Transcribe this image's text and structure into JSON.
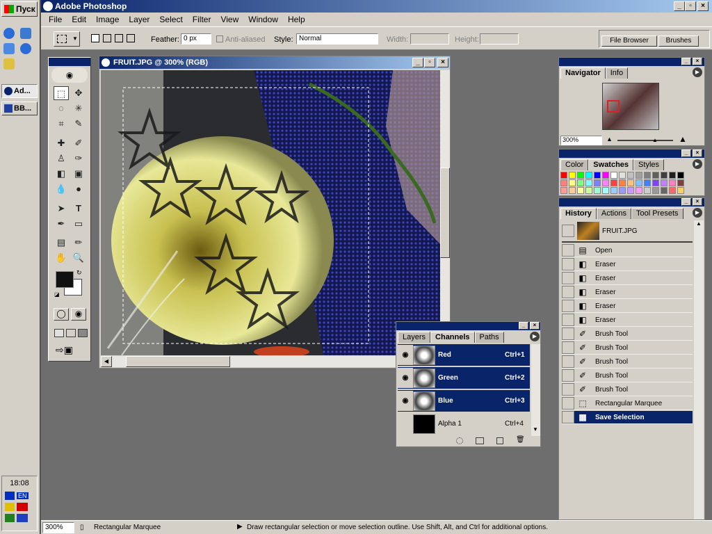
{
  "taskbar": {
    "start_label": "Пуск",
    "tasks": [
      "Ad...",
      "BB..."
    ],
    "clock": "18:08",
    "lang": "EN"
  },
  "app": {
    "title": "Adobe Photoshop",
    "menus": [
      "File",
      "Edit",
      "Image",
      "Layer",
      "Select",
      "Filter",
      "View",
      "Window",
      "Help"
    ]
  },
  "options": {
    "feather_label": "Feather:",
    "feather_value": "0 px",
    "antialiased_label": "Anti-aliased",
    "style_label": "Style:",
    "style_value": "Normal",
    "width_label": "Width:",
    "height_label": "Height:",
    "file_browser": "File Browser",
    "brushes": "Brushes"
  },
  "document": {
    "title": "FRUIT.JPG @ 300% (RGB)"
  },
  "navigator": {
    "tabs": [
      "Navigator",
      "Info"
    ],
    "zoom": "300%"
  },
  "swatches": {
    "tabs": [
      "Color",
      "Swatches",
      "Styles"
    ],
    "row1": [
      "#ff0000",
      "#ffff00",
      "#00ff00",
      "#00ffff",
      "#0000ff",
      "#ff00ff",
      "#ffffff",
      "#e0e0e0",
      "#c0c0c0",
      "#a0a0a0",
      "#808080",
      "#606060",
      "#404040",
      "#202020",
      "#000000"
    ],
    "row2": [
      "#ff8080",
      "#ffff80",
      "#80ff80",
      "#80ffff",
      "#8080ff",
      "#ff80ff",
      "#ff4040",
      "#ff8040",
      "#ffc080",
      "#80c0ff",
      "#4080ff",
      "#8040ff",
      "#c080ff",
      "#ff80c0",
      "#804040"
    ],
    "row3": [
      "#ff9999",
      "#ffcc99",
      "#ffff99",
      "#ccff99",
      "#99ffcc",
      "#99ffff",
      "#99ccff",
      "#9999ff",
      "#cc99ff",
      "#ff99ff",
      "#cccccc",
      "#999999",
      "#666666",
      "#ff6666",
      "#ffcc66"
    ]
  },
  "history": {
    "tabs": [
      "History",
      "Actions",
      "Tool Presets"
    ],
    "snapshot": "FRUIT.JPG",
    "items": [
      {
        "label": "Open",
        "icon": "open-doc-icon"
      },
      {
        "label": "Eraser",
        "icon": "eraser-icon"
      },
      {
        "label": "Eraser",
        "icon": "eraser-icon"
      },
      {
        "label": "Eraser",
        "icon": "eraser-icon"
      },
      {
        "label": "Eraser",
        "icon": "eraser-icon"
      },
      {
        "label": "Eraser",
        "icon": "eraser-icon"
      },
      {
        "label": "Brush Tool",
        "icon": "brush-icon"
      },
      {
        "label": "Brush Tool",
        "icon": "brush-icon"
      },
      {
        "label": "Brush Tool",
        "icon": "brush-icon"
      },
      {
        "label": "Brush Tool",
        "icon": "brush-icon"
      },
      {
        "label": "Brush Tool",
        "icon": "brush-icon"
      },
      {
        "label": "Rectangular Marquee",
        "icon": "marquee-icon"
      },
      {
        "label": "Save Selection",
        "icon": "save-selection-icon"
      }
    ]
  },
  "channels": {
    "tabs": [
      "Layers",
      "Channels",
      "Paths"
    ],
    "items": [
      {
        "name": "Red",
        "shortcut": "Ctrl+1"
      },
      {
        "name": "Green",
        "shortcut": "Ctrl+2"
      },
      {
        "name": "Blue",
        "shortcut": "Ctrl+3"
      },
      {
        "name": "Alpha 1",
        "shortcut": "Ctrl+4"
      }
    ]
  },
  "status": {
    "zoom": "300%",
    "tool": "Rectangular Marquee",
    "hint": "Draw rectangular selection or move selection outline.  Use Shift, Alt, and Ctrl for additional options."
  }
}
